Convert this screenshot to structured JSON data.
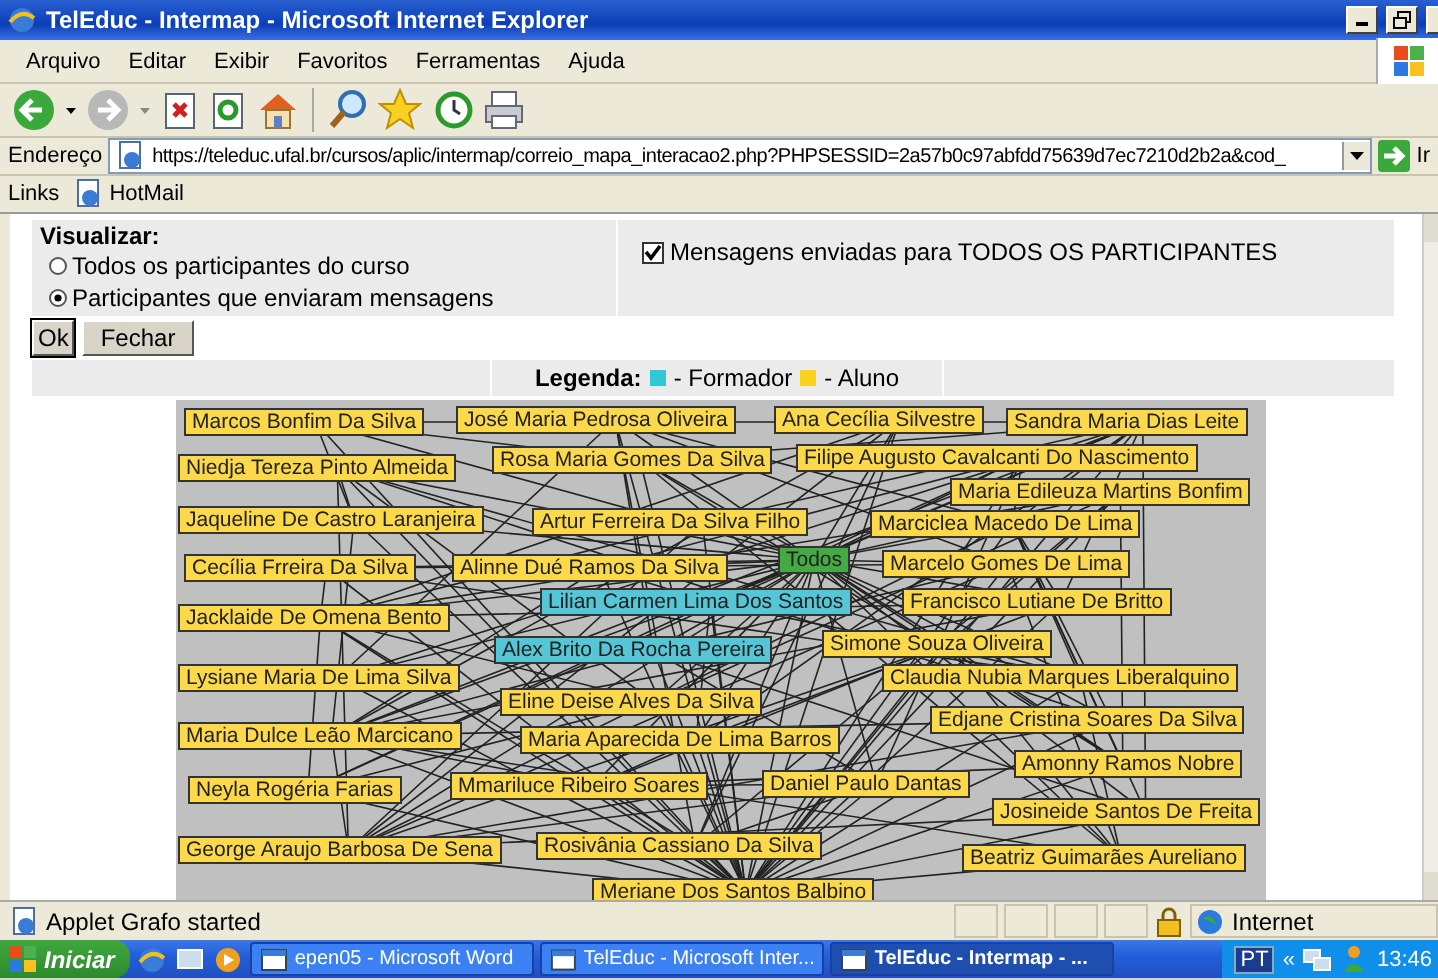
{
  "window": {
    "title": "TelEduc - Intermap - Microsoft Internet Explorer"
  },
  "menu": [
    "Arquivo",
    "Editar",
    "Exibir",
    "Favoritos",
    "Ferramentas",
    "Ajuda"
  ],
  "address_bar": {
    "label": "Endereço",
    "url": "https://teleduc.ufal.br/cursos/aplic/intermap/correio_mapa_interacao2.php?PHPSESSID=2a57b0c97abfdd75639d7ec7210d2b2a&cod_",
    "go": "Ir"
  },
  "links_bar": {
    "label": "Links",
    "links": [
      "HotMail"
    ]
  },
  "form": {
    "heading": "Visualizar:",
    "radios": [
      {
        "label": "Todos os participantes do curso",
        "selected": false
      },
      {
        "label": "Participantes que enviaram mensagens",
        "selected": true
      }
    ],
    "checkbox": {
      "label": "Mensagens enviadas para TODOS OS PARTICIPANTES",
      "checked": true
    },
    "buttons": [
      "Ok",
      "Fechar"
    ]
  },
  "legend": {
    "label": "Legenda:",
    "items": [
      {
        "label": "- Formador",
        "color": "#33c6d6"
      },
      {
        "label": "- Aluno",
        "color": "#fcd21e"
      }
    ]
  },
  "graph": {
    "nodes": [
      {
        "label": "Marcos Bonfim Da Silva",
        "kind": "aluno"
      },
      {
        "label": "José Maria Pedrosa Oliveira",
        "kind": "aluno"
      },
      {
        "label": "Ana Cecília Silvestre",
        "kind": "aluno"
      },
      {
        "label": "Sandra Maria Dias Leite",
        "kind": "aluno"
      },
      {
        "label": "Niedja Tereza Pinto Almeida",
        "kind": "aluno"
      },
      {
        "label": "Rosa Maria Gomes Da Silva",
        "kind": "aluno"
      },
      {
        "label": "Filipe Augusto Cavalcanti Do Nascimento",
        "kind": "aluno"
      },
      {
        "label": "Maria Edileuza Martins Bonfim",
        "kind": "aluno"
      },
      {
        "label": "Jaqueline De Castro Laranjeira",
        "kind": "aluno"
      },
      {
        "label": "Artur Ferreira Da Silva Filho",
        "kind": "aluno"
      },
      {
        "label": "Marciclea Macedo De Lima",
        "kind": "aluno"
      },
      {
        "label": "Todos",
        "kind": "todos"
      },
      {
        "label": "Cecília Frreira Da Silva",
        "kind": "aluno"
      },
      {
        "label": "Alinne Dué Ramos Da Silva",
        "kind": "aluno"
      },
      {
        "label": "Marcelo Gomes De Lima",
        "kind": "aluno"
      },
      {
        "label": "Lilian Carmen Lima Dos Santos",
        "kind": "formador"
      },
      {
        "label": "Francisco Lutiane De Britto",
        "kind": "aluno"
      },
      {
        "label": "Jacklaide De Omena Bento",
        "kind": "aluno"
      },
      {
        "label": "Alex Brito Da Rocha Pereira",
        "kind": "formador"
      },
      {
        "label": "Simone Souza Oliveira",
        "kind": "aluno"
      },
      {
        "label": "Lysiane Maria De Lima Silva",
        "kind": "aluno"
      },
      {
        "label": "Claudia Nubia Marques Liberalquino",
        "kind": "aluno"
      },
      {
        "label": "Eline Deise Alves Da Silva",
        "kind": "aluno"
      },
      {
        "label": "Edjane Cristina Soares Da Silva",
        "kind": "aluno"
      },
      {
        "label": "Maria Dulce Leão Marcicano",
        "kind": "aluno"
      },
      {
        "label": "Maria Aparecida De Lima Barros",
        "kind": "aluno"
      },
      {
        "label": "Amonny Ramos Nobre",
        "kind": "aluno"
      },
      {
        "label": "Neyla Rogéria Farias",
        "kind": "aluno"
      },
      {
        "label": "Mmariluce Ribeiro Soares",
        "kind": "aluno"
      },
      {
        "label": "Daniel Paulo Dantas",
        "kind": "aluno"
      },
      {
        "label": "Josineide Santos De Freita",
        "kind": "aluno"
      },
      {
        "label": "George Araujo Barbosa De Sena",
        "kind": "aluno"
      },
      {
        "label": "Rosivânia Cassiano Da Silva",
        "kind": "aluno"
      },
      {
        "label": "Beatriz Guimarães Aureliano",
        "kind": "aluno"
      },
      {
        "label": "Meriane Dos Santos Balbino",
        "kind": "aluno"
      }
    ]
  },
  "status_bar": {
    "text": "Applet Grafo started",
    "zone": "Internet"
  },
  "taskbar": {
    "start": "Iniciar",
    "tasks": [
      {
        "label": "epen05 - Microsoft Word",
        "selected": false
      },
      {
        "label": "TelEduc - Microsoft Inter...",
        "selected": false
      },
      {
        "label": "TelEduc - Intermap - ...",
        "selected": true
      }
    ],
    "language": "PT",
    "chevron": "«",
    "clock": "13:46"
  }
}
